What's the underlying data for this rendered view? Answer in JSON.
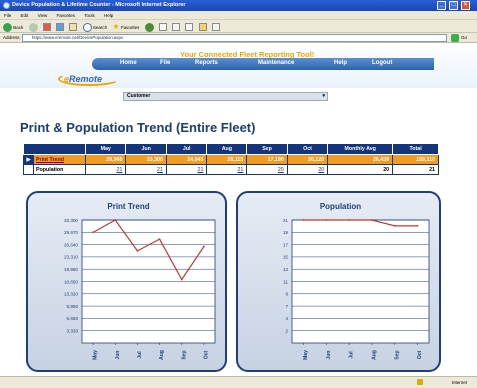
{
  "browser": {
    "window_title": "Device Population & Lifetime Counter - Microsoft Internet Explorer",
    "menu": [
      "File",
      "Edit",
      "View",
      "Favorites",
      "Tools",
      "Help"
    ],
    "toolbar": {
      "back": "Back",
      "search": "Search",
      "favorites": "Favorites"
    },
    "address_label": "Address",
    "address_url": "https://www.eremote.net/DevicePopulation.aspx",
    "go_label": "Go",
    "status_zone": "Internet"
  },
  "site": {
    "slogan": "Your Connected Fleet Reporting Tool!",
    "nav": [
      "Home",
      "File",
      "Reports",
      "Maintenance",
      "Help",
      "Logout"
    ],
    "logo_text": "Remote",
    "logo_prefix": "e",
    "customer_select": "Customer"
  },
  "page": {
    "title": "Print & Population Trend (Entire Fleet)"
  },
  "table": {
    "headers": [
      "",
      "May",
      "Jun",
      "Jul",
      "Aug",
      "Sep",
      "Oct",
      "Monthly Avg",
      "Total"
    ],
    "rows": [
      {
        "label": "Print Trend",
        "values": [
          "29,960",
          "33,300",
          "24,945",
          "28,115",
          "17,190",
          "26,120",
          "26,438",
          "159,110"
        ]
      },
      {
        "label": "Population",
        "values": [
          "21",
          "21",
          "21",
          "21",
          "20",
          "20",
          "20",
          "21"
        ]
      }
    ]
  },
  "chart_data": [
    {
      "type": "line",
      "title": "Print Trend",
      "categories": [
        "May",
        "Jun",
        "Jul",
        "Aug",
        "Sep",
        "Oct"
      ],
      "values": [
        29960,
        33300,
        24945,
        28115,
        17190,
        26120
      ],
      "yticks": [
        "3,330",
        "6,660",
        "9,990",
        "13,320",
        "16,650",
        "19,980",
        "23,310",
        "26,640",
        "29,970",
        "33,300"
      ],
      "ylim": [
        0,
        33300
      ],
      "color": "#c0392b",
      "grid": true
    },
    {
      "type": "line",
      "title": "Population",
      "categories": [
        "May",
        "Jun",
        "Jul",
        "Aug",
        "Sep",
        "Oct"
      ],
      "values": [
        21,
        21,
        21,
        21,
        20,
        20
      ],
      "yticks": [
        "2",
        "4",
        "7",
        "9",
        "11",
        "13",
        "15",
        "17",
        "19",
        "21"
      ],
      "ylim": [
        0,
        21
      ],
      "color": "#c0392b",
      "grid": true
    }
  ],
  "colors": {
    "accent": "#f29b22",
    "header": "#14357a",
    "title": "#1b3f6f"
  }
}
